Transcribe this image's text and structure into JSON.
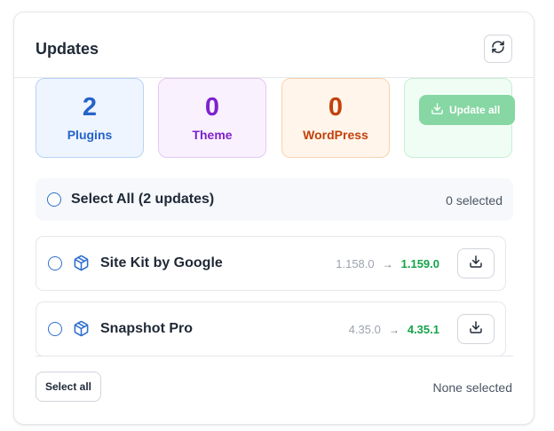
{
  "panel": {
    "title": "Updates",
    "refresh_icon": "refresh-icon"
  },
  "stats": [
    {
      "count": "2",
      "label": "Plugins"
    },
    {
      "count": "0",
      "label": "Theme"
    },
    {
      "count": "0",
      "label": "WordPress"
    }
  ],
  "update_all": {
    "label": "Update all",
    "icon": "download-icon"
  },
  "select_all_bar": {
    "label": "Select All (2 updates)",
    "selected_count": "0 selected"
  },
  "updates": [
    {
      "name": "Site Kit by Google",
      "from_version": "1.158.0",
      "to_version": "1.159.0",
      "icon": "package-icon"
    },
    {
      "name": "Snapshot Pro",
      "from_version": "4.35.0",
      "to_version": "4.35.1",
      "icon": "package-icon"
    }
  ],
  "version_arrow": "→",
  "footer": {
    "select_all_label": "Select all",
    "status": "None selected"
  },
  "colors": {
    "plugins": "#2563c9",
    "theme": "#7e22ce",
    "wordpress": "#c2410c",
    "update_all_bg": "#86d7a3",
    "new_version": "#16a34a"
  }
}
